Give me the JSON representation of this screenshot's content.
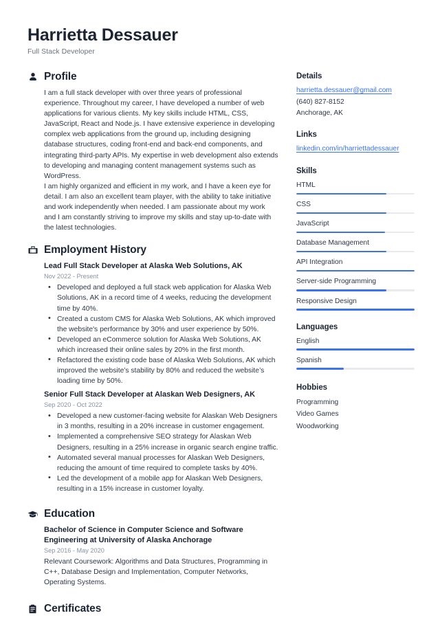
{
  "header": {
    "name": "Harrietta Dessauer",
    "title": "Full Stack Developer"
  },
  "sections": {
    "profile": {
      "title": "Profile",
      "icon": "user-icon",
      "text": "I am a full stack developer with over three years of professional experience. Throughout my career, I have developed a number of web applications for various clients. My key skills include HTML, CSS, JavaScript, React and Node.js. I have extensive experience in developing complex web applications from the ground up, including designing database structures, coding front-end and back-end components, and integrating third-party APIs. My expertise in web development also extends to developing and managing content management systems such as WordPress.\nI am highly organized and efficient in my work, and I have a keen eye for detail. I am also an excellent team player, with the ability to take initiative and work independently when needed. I am passionate about my work and I am constantly striving to improve my skills and stay up-to-date with the latest technologies."
    },
    "employment": {
      "title": "Employment History",
      "icon": "briefcase-icon",
      "entries": [
        {
          "title": "Lead Full Stack Developer at Alaska Web Solutions, AK",
          "date": "Nov 2022 - Present",
          "bullets": [
            "Developed and deployed a full stack web application for Alaska Web Solutions, AK in a record time of 4 weeks, reducing the development time by 40%.",
            "Created a custom CMS for Alaska Web Solutions, AK which improved the website's performance by 30% and user experience by 50%.",
            "Developed an eCommerce solution for Alaska Web Solutions, AK which increased their online sales by 20% in the first month.",
            "Refactored the existing code base of Alaska Web Solutions, AK which improved the website’s stability by 80% and reduced the website’s loading time by 50%."
          ]
        },
        {
          "title": "Senior Full Stack Developer at Alaskan Web Designers, AK",
          "date": "Sep 2020 - Oct 2022",
          "bullets": [
            "Developed a new customer-facing website for Alaskan Web Designers in 3 months, resulting in a 20% increase in customer engagement.",
            "Implemented a comprehensive SEO strategy for Alaskan Web Designers, resulting in a 25% increase in organic search engine traffic.",
            "Automated several manual processes for Alaskan Web Designers, reducing the amount of time required to complete tasks by 40%.",
            "Led the development of a mobile app for Alaskan Web Designers, resulting in a 15% increase in customer loyalty."
          ]
        }
      ]
    },
    "education": {
      "title": "Education",
      "icon": "graduation-cap-icon",
      "entries": [
        {
          "title": "Bachelor of Science in Computer Science and Software Engineering at University of Alaska Anchorage",
          "date": "Sep 2016 - May 2020",
          "description": "Relevant Coursework: Algorithms and Data Structures, Programming in C++, Database Design and Implementation, Computer Networks, Operating Systems."
        }
      ]
    },
    "certificates": {
      "title": "Certificates",
      "icon": "certificate-icon"
    }
  },
  "sidebar": {
    "details": {
      "title": "Details",
      "email": "harrietta.dessauer@gmail.com",
      "phone": "(640) 827-8152",
      "location": "Anchorage, AK"
    },
    "links": {
      "title": "Links",
      "items": [
        {
          "label": "linkedin.com/in/harriettadessauer"
        }
      ]
    },
    "skills": {
      "title": "Skills",
      "items": [
        {
          "label": "HTML",
          "level": 76
        },
        {
          "label": "CSS",
          "level": 76
        },
        {
          "label": "JavaScript",
          "level": 75
        },
        {
          "label": "Database Management",
          "level": 76
        },
        {
          "label": "API Integration",
          "level": 100
        },
        {
          "label": "Server-side Programming",
          "level": 76
        },
        {
          "label": "Responsive Design",
          "level": 100
        }
      ]
    },
    "languages": {
      "title": "Languages",
      "items": [
        {
          "label": "English",
          "level": 100
        },
        {
          "label": "Spanish",
          "level": 40
        }
      ]
    },
    "hobbies": {
      "title": "Hobbies",
      "items": [
        {
          "label": "Programming"
        },
        {
          "label": "Video Games"
        },
        {
          "label": "Woodworking"
        }
      ]
    }
  },
  "colors": {
    "accent": "#3b72f0",
    "heading": "#1c2434",
    "body_text": "#2d3748",
    "muted": "#8a93a0",
    "track": "#e8eaed"
  }
}
